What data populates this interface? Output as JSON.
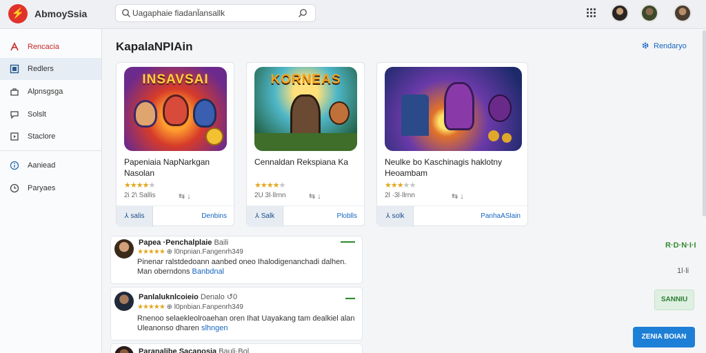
{
  "app": {
    "brand": "AbmoySsia",
    "logo_glyph": "⚡"
  },
  "search": {
    "text": "Uagaphaie fiadanl̈ansallk"
  },
  "sidebar": {
    "items": [
      {
        "label": "Rencacia",
        "icon": "logo-icon",
        "state": "red"
      },
      {
        "label": "Redlers",
        "icon": "square-icon",
        "state": "active"
      },
      {
        "label": "Alpnsgsga",
        "icon": "bag-icon",
        "state": ""
      },
      {
        "label": "Solslt",
        "icon": "chat-icon",
        "state": ""
      },
      {
        "label": "Staclore",
        "icon": "store-icon",
        "state": ""
      },
      {
        "label": "Aaniead",
        "icon": "info-icon",
        "state": ""
      },
      {
        "label": "Paryaes",
        "icon": "clock-icon",
        "state": ""
      }
    ]
  },
  "main": {
    "title": "KapalaNPIAin",
    "top_action": "Rendaryo",
    "cards": [
      {
        "thumb_title": "INSAVSAI",
        "title": "Papeniaia NapNarkgan Nasolan",
        "rating": 4,
        "meta": "2i 2\\ Sallis",
        "icons": "⇆ ↓",
        "left_label": "⅄ salis",
        "right_label": "Denbins"
      },
      {
        "thumb_title": "KORNEAS",
        "title": "Cennaldan Rekspiana Ka",
        "rating": 4,
        "meta": "2U 3l·llrnn",
        "icons": "⇆ ↓",
        "left_label": "⅄ Salk",
        "right_label": "Ploblls"
      },
      {
        "thumb_title": "",
        "title": "Neulke bo Kaschinagis haklotny Heoambam",
        "rating": 3,
        "meta": "2l ·3l·llrnn",
        "icons": "⇆ ↓",
        "left_label": "⅄ solk",
        "right_label": "PanhaASlain"
      }
    ],
    "reviews": [
      {
        "name": "Papea ·Penchalplaie",
        "name_extra": "Baili",
        "badge": "▬▬▬",
        "rating": 5,
        "sub": "⊕ l0npnian.Fangenrh349",
        "text": "Pinenar ralstdedoann aanbed oneo Ihalodigenanchadi dalhen. Man oberndons",
        "link": "Banbdnal"
      },
      {
        "name": "Panlaluknlcoieio",
        "name_extra": "Denalo ↺0",
        "badge": "▬▬",
        "rating": 5,
        "sub": "⊕ l0pnbian.Fanpenrh349",
        "text": "Rnenoo selaekleolroaehan oren Ihat Uayakang tam dealkiel alan Uleanonso dharen",
        "link": "slhngen"
      },
      {
        "name": "Paranalibe Sacanosia",
        "name_extra": "Baulj·Bol",
        "badge": "",
        "rating": 0,
        "sub": "",
        "text": "",
        "link": ""
      }
    ],
    "side_stats": {
      "green": "R·D·N·I·I",
      "gray": "1l·li",
      "green_button": "SANNIU",
      "primary_button": "ZENIA BOIAN"
    }
  },
  "colors": {
    "accent": "#1e7fd6",
    "brand_red": "#e0322a",
    "star": "#e2a71c",
    "success": "#2e8b2e"
  }
}
